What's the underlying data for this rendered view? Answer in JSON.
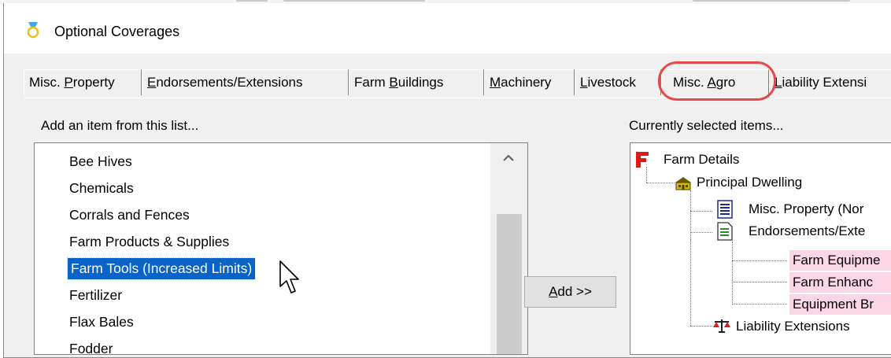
{
  "window": {
    "title": "Optional Coverages",
    "icon": "ring-icon"
  },
  "tabs": [
    {
      "pre": "Misc. ",
      "key": "P",
      "post": "roperty"
    },
    {
      "pre": "",
      "key": "E",
      "post": "ndorsements/Extensions"
    },
    {
      "pre": "Farm ",
      "key": "B",
      "post": "uildings"
    },
    {
      "pre": "",
      "key": "M",
      "post": "achinery"
    },
    {
      "pre": "",
      "key": "L",
      "post": "ivestock"
    },
    {
      "pre": "Misc. ",
      "key": "A",
      "post": "gro"
    },
    {
      "pre": "",
      "key": "L",
      "post": "iability Extensi"
    }
  ],
  "active_tab_index": 5,
  "available": {
    "label": "Add an item from this list...",
    "items": [
      "Bee Hives",
      "Chemicals",
      "Corrals and Fences",
      "Farm Products & Supplies",
      "Farm Tools (Increased Limits)",
      "Fertilizer",
      "Flax Bales",
      "Fodder"
    ],
    "selected_index": 4
  },
  "add_button": {
    "key": "A",
    "rest": "dd >>"
  },
  "selected": {
    "label": "Currently selected items...",
    "tree": [
      {
        "text": "Farm Details",
        "icon": "farm-f-icon"
      },
      {
        "text": "Principal Dwelling",
        "icon": "house-icon"
      },
      {
        "text": "Misc. Property (Nor",
        "icon": "document-icon"
      },
      {
        "text": "Endorsements/Exte",
        "icon": "endorsement-doc-icon"
      },
      {
        "text": "Farm Equipme"
      },
      {
        "text": "Farm Enhanc"
      },
      {
        "text": "Equipment Br"
      },
      {
        "text": "Liability Extensions",
        "icon": "scales-icon"
      }
    ]
  },
  "colors": {
    "selection": "#0a64c8",
    "highlight_ring": "#e64a4a",
    "pink_row": "#fbd6e6"
  }
}
